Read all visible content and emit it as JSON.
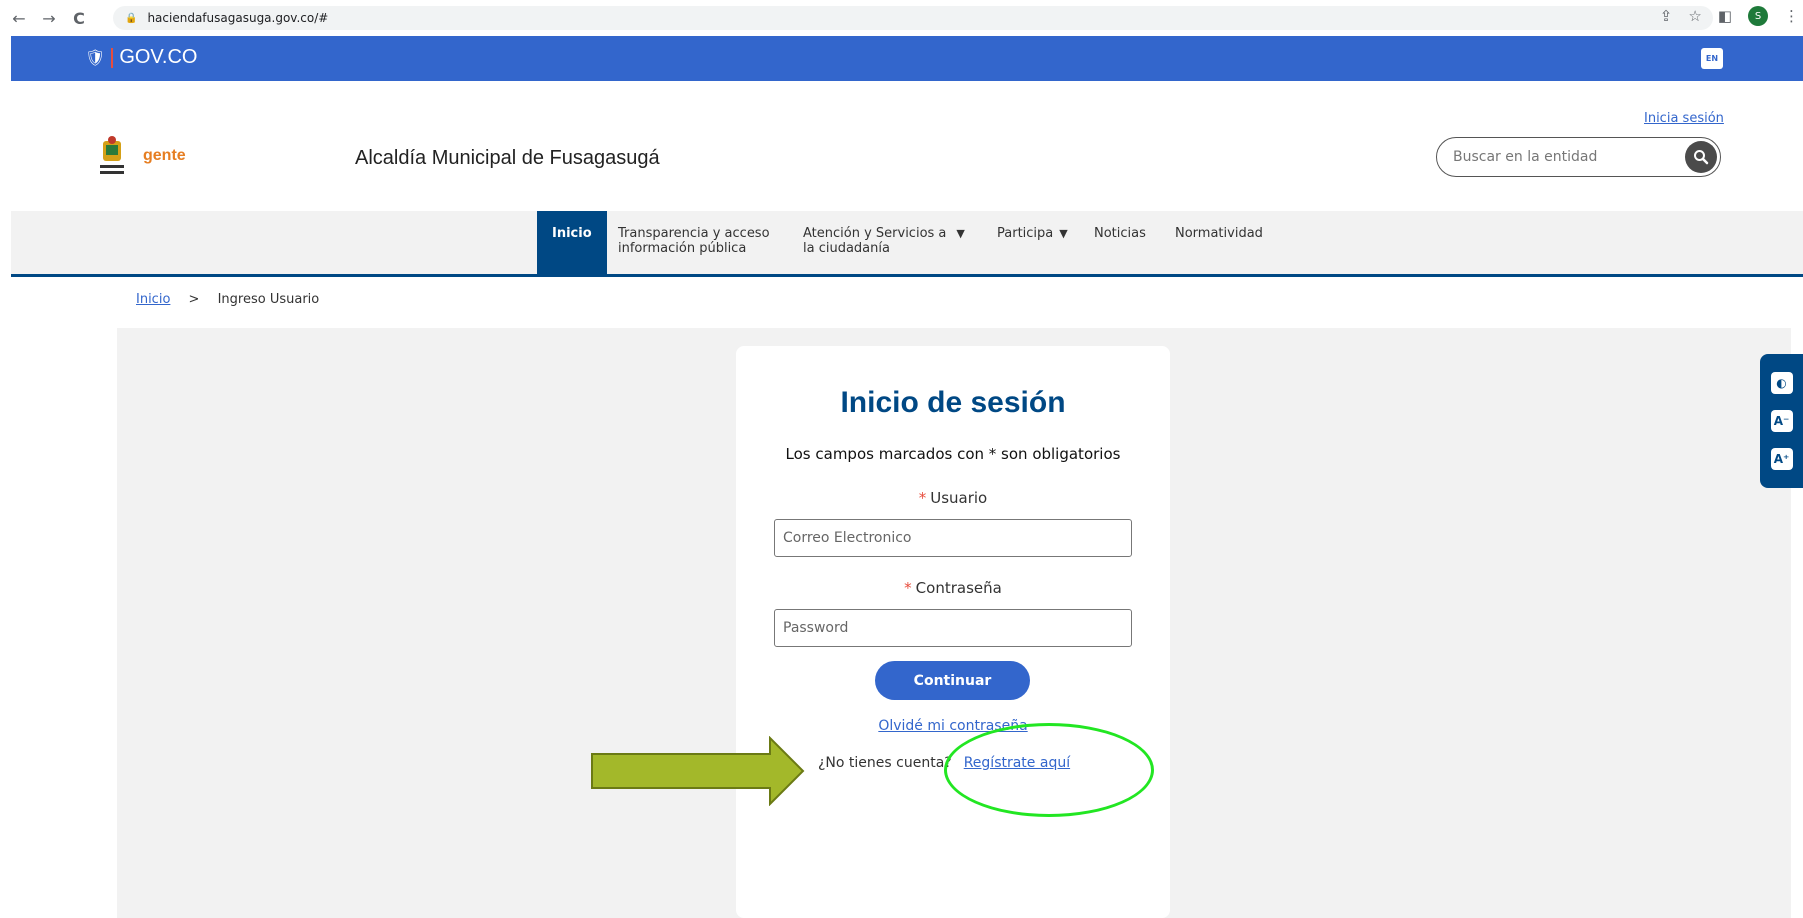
{
  "browser": {
    "url": "haciendafusagasuga.gov.co/#",
    "profile_initial": "S"
  },
  "gov_bar": {
    "logo_text": "GOV.CO",
    "lang_label": "EN"
  },
  "header": {
    "gente_logo": "gente",
    "entity_title": "Alcaldía Municipal de Fusagasugá",
    "login_link": "Inicia sesión",
    "search_placeholder": "Buscar en la entidad"
  },
  "nav": {
    "items": [
      {
        "label": "Inicio"
      },
      {
        "label_line1": "Transparencia y acceso",
        "label_line2": "información pública"
      },
      {
        "label_line1": "Atención y Servicios a",
        "label_line2": "la ciudadanía"
      },
      {
        "label": "Participa"
      },
      {
        "label": "Noticias"
      },
      {
        "label": "Normatividad"
      }
    ]
  },
  "breadcrumb": {
    "home": "Inicio",
    "separator": ">",
    "current": "Ingreso Usuario"
  },
  "login": {
    "title": "Inicio de sesión",
    "required_note": "Los campos marcados con * son obligatorios",
    "required_mark": "*",
    "user_label": "Usuario",
    "user_placeholder": "Correo Electronico",
    "password_label": "Contraseña",
    "password_placeholder": "Password",
    "continue_label": "Continuar",
    "forgot_link": "Olvidé mi contraseña",
    "no_account": "¿No tienes cuenta?",
    "register_link": "Regístrate aquí"
  },
  "colors": {
    "gov_blue": "#3366cc",
    "dark_blue": "#004884",
    "arrow_green": "#a3b82a",
    "highlight_green": "#22e622"
  }
}
